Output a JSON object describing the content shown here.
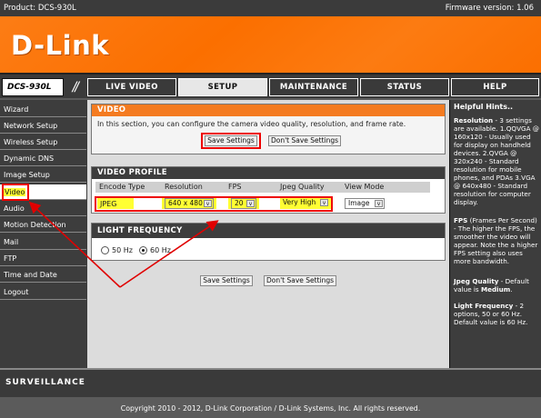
{
  "topbar": {
    "product": "Product: DCS-930L",
    "firmware": "Firmware version: 1.06"
  },
  "brand": {
    "logo_text": "D-Link"
  },
  "model_label": "DCS-930L",
  "tabs": [
    {
      "label": "LIVE VIDEO"
    },
    {
      "label": "SETUP"
    },
    {
      "label": "MAINTENANCE"
    },
    {
      "label": "STATUS"
    },
    {
      "label": "HELP"
    }
  ],
  "sidebar": {
    "items": [
      {
        "label": "Wizard"
      },
      {
        "label": "Network Setup"
      },
      {
        "label": "Wireless Setup"
      },
      {
        "label": "Dynamic DNS"
      },
      {
        "label": "Image Setup"
      },
      {
        "label": "Video"
      },
      {
        "label": "Audio"
      },
      {
        "label": "Motion Detection"
      },
      {
        "label": "Mail"
      },
      {
        "label": "FTP"
      },
      {
        "label": "Time and Date"
      },
      {
        "label": "Logout"
      }
    ]
  },
  "video_panel": {
    "title": "VIDEO",
    "intro": "In this section, you can configure the camera video quality, resolution, and frame rate.",
    "save_label": "Save Settings",
    "dont_save_label": "Don't Save Settings"
  },
  "video_profile": {
    "title": "VIDEO PROFILE",
    "headers": [
      "Encode Type",
      "Resolution",
      "FPS",
      "Jpeg Quality",
      "View Mode"
    ],
    "encode_type": "JPEG",
    "resolution": "640 x 480",
    "fps": "20",
    "jpeg_quality": "Very High",
    "view_mode": "Image",
    "dropdown_arrow": "v"
  },
  "light_frequency": {
    "title": "LIGHT FREQUENCY",
    "options": [
      "50 Hz",
      "60 Hz"
    ],
    "selected": "60 Hz"
  },
  "bottom_buttons": {
    "save_label": "Save Settings",
    "dont_save_label": "Don't Save Settings"
  },
  "hints": {
    "title": "Helpful Hints..",
    "resolution_title": "Resolution",
    "resolution_text": " - 3 settings are available. 1.QQVGA @ 160x120 - Usually used for display on handheld devices. 2.QVGA @ 320x240 - Standard resolution for mobile phones, and PDAs 3.VGA @ 640x480 - Standard resolution for computer display.",
    "fps_title": "FPS",
    "fps_text": " (Frames Per Second) - The higher the FPS, the smoother the video will appear. Note the a higher FPS setting also uses more bandwidth.",
    "jpeg_title": "Jpeg Quality",
    "jpeg_text": " - Default value is ",
    "jpeg_default": "Medium",
    "jpeg_end": ".",
    "light_title": "Light Frequency",
    "light_text": " - 2 options, 50 or 60 Hz. Default value is 60 Hz."
  },
  "surveillance_label": "SURVEILLANCE",
  "footer": "Copyright 2010 - 2012, D-Link Corporation / D-Link Systems, Inc. All rights reserved.",
  "colors": {
    "brand_orange": "#fb6f00",
    "dark_bar": "#3a3a3a",
    "highlight_yellow": "#ffff33",
    "annotation_red": "#e00000"
  }
}
